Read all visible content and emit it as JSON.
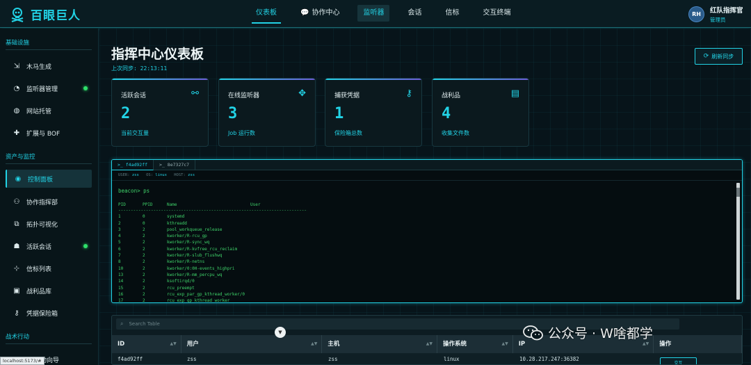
{
  "app": {
    "name": "百眼巨人",
    "brand_color": "#22d3e6"
  },
  "nav": {
    "items": [
      {
        "label": "仪表板",
        "state": "active"
      },
      {
        "label": "协作中心",
        "icon": "chat-icon"
      },
      {
        "label": "监听器",
        "state": "highlight"
      },
      {
        "label": "会话"
      },
      {
        "label": "信标"
      },
      {
        "label": "交互终端"
      }
    ]
  },
  "user": {
    "initials": "RH",
    "name": "红队指挥官",
    "role": "管理员"
  },
  "sidebar": {
    "sections": [
      {
        "title": "基础设施"
      },
      {
        "title": "资产与监控"
      },
      {
        "title": "战术行动"
      }
    ],
    "items": [
      {
        "label": "木马生成",
        "icon": "file-export-icon"
      },
      {
        "label": "监听器管理",
        "icon": "satellite-dish-icon",
        "status": "online"
      },
      {
        "label": "网站托管",
        "icon": "globe-icon"
      },
      {
        "label": "扩展与 BOF",
        "icon": "puzzle-icon"
      },
      {
        "label": "控制面板",
        "icon": "gauge-icon",
        "state": "active"
      },
      {
        "label": "协作指挥部",
        "icon": "users-icon"
      },
      {
        "label": "拓扑可视化",
        "icon": "topology-icon"
      },
      {
        "label": "活跃会话",
        "icon": "robot-icon",
        "status": "online"
      },
      {
        "label": "信标列表",
        "icon": "broadcast-tower-icon"
      },
      {
        "label": "战利品库",
        "icon": "camera-icon"
      },
      {
        "label": "凭据保险箱",
        "icon": "key-icon"
      },
      {
        "label": "动向导",
        "icon": "wizard-icon"
      }
    ]
  },
  "main": {
    "title": "指挥中心仪表板",
    "sync_label": "上次同步: 22:13:11",
    "refresh_label": "刷新同步"
  },
  "cards": [
    {
      "label": "活跃会话",
      "value": "2",
      "sub": "当前交互量",
      "icon": "link-icon"
    },
    {
      "label": "在线监听器",
      "value": "3",
      "sub": "Job 运行数",
      "icon": "satellite-icon"
    },
    {
      "label": "捕获凭据",
      "value": "1",
      "sub": "保险箱总数",
      "icon": "key-icon"
    },
    {
      "label": "战利品",
      "value": "4",
      "sub": "收集文件数",
      "icon": "gift-icon"
    }
  ],
  "terminal": {
    "tabs": [
      {
        "label": ">_ f4ad92ff",
        "state": "active"
      },
      {
        "label": ">_ 8e7327c7"
      }
    ],
    "meta": {
      "user_label": "USER:",
      "user": "zss",
      "os_label": "OS:",
      "os": "linux",
      "host_label": "HOST:",
      "host": "zss"
    },
    "prompt": "beacon> ps",
    "headers": {
      "pid": "PID",
      "ppid": "PPID",
      "name": "Name",
      "user": "User"
    },
    "divider": "------------------------------------------------------------------------------------------------",
    "processes": [
      {
        "pid": "1",
        "ppid": "0",
        "name": "systemd"
      },
      {
        "pid": "2",
        "ppid": "0",
        "name": "kthreadd"
      },
      {
        "pid": "3",
        "ppid": "2",
        "name": "pool_workqueue_release"
      },
      {
        "pid": "4",
        "ppid": "2",
        "name": "kworker/R-rcu_gp"
      },
      {
        "pid": "5",
        "ppid": "2",
        "name": "kworker/R-sync_wq"
      },
      {
        "pid": "6",
        "ppid": "2",
        "name": "kworker/R-kvfree_rcu_reclaim"
      },
      {
        "pid": "7",
        "ppid": "2",
        "name": "kworker/R-slub_flushwq"
      },
      {
        "pid": "8",
        "ppid": "2",
        "name": "kworker/R-netns"
      },
      {
        "pid": "10",
        "ppid": "2",
        "name": "kworker/0:0H-events_highpri"
      },
      {
        "pid": "13",
        "ppid": "2",
        "name": "kworker/R-mm_percpu_wq"
      },
      {
        "pid": "14",
        "ppid": "2",
        "name": "ksoftirqd/0"
      },
      {
        "pid": "15",
        "ppid": "2",
        "name": "rcu_preempt"
      },
      {
        "pid": "16",
        "ppid": "2",
        "name": "rcu_exp_par_gp_kthread_worker/0"
      },
      {
        "pid": "17",
        "ppid": "2",
        "name": "rcu_exp_gp_kthread_worker"
      }
    ]
  },
  "table": {
    "search_placeholder": "Search Table",
    "columns": [
      "ID",
      "用户",
      "主机",
      "操作系统",
      "IP",
      "操作"
    ],
    "rows": [
      {
        "id": "f4ad92ff",
        "user": "zss",
        "host": "zss",
        "os": "linux",
        "ip": "10.28.217.247:36382",
        "action": "交互"
      }
    ]
  },
  "overlay": {
    "watermark": "公众号 · W啥都学",
    "status_url": "localhost:5173/#"
  }
}
